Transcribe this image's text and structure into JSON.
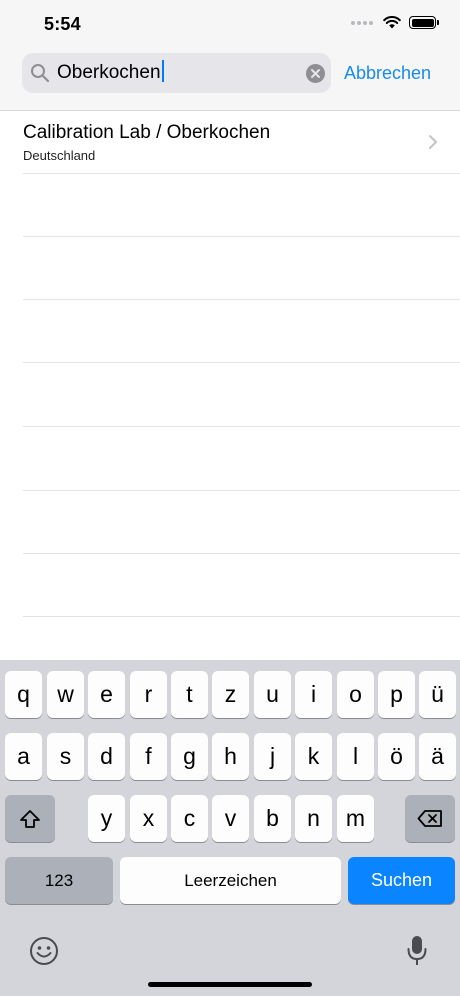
{
  "status_bar": {
    "time": "5:54"
  },
  "search": {
    "value": "Oberkochen",
    "cancel_label": "Abbrechen"
  },
  "results": [
    {
      "title": "Calibration Lab / Oberkochen",
      "subtitle": "Deutschland"
    }
  ],
  "keyboard": {
    "row1": [
      "q",
      "w",
      "e",
      "r",
      "t",
      "z",
      "u",
      "i",
      "o",
      "p",
      "ü"
    ],
    "row2": [
      "a",
      "s",
      "d",
      "f",
      "g",
      "h",
      "j",
      "k",
      "l",
      "ö",
      "ä"
    ],
    "row3": [
      "y",
      "x",
      "c",
      "v",
      "b",
      "n",
      "m"
    ],
    "numbers_label": "123",
    "space_label": "Leerzeichen",
    "return_label": "Suchen"
  },
  "colors": {
    "accent": "#1a8ae8",
    "return_key": "#0a84ff",
    "keyboard_bg": "#d3d5db"
  }
}
